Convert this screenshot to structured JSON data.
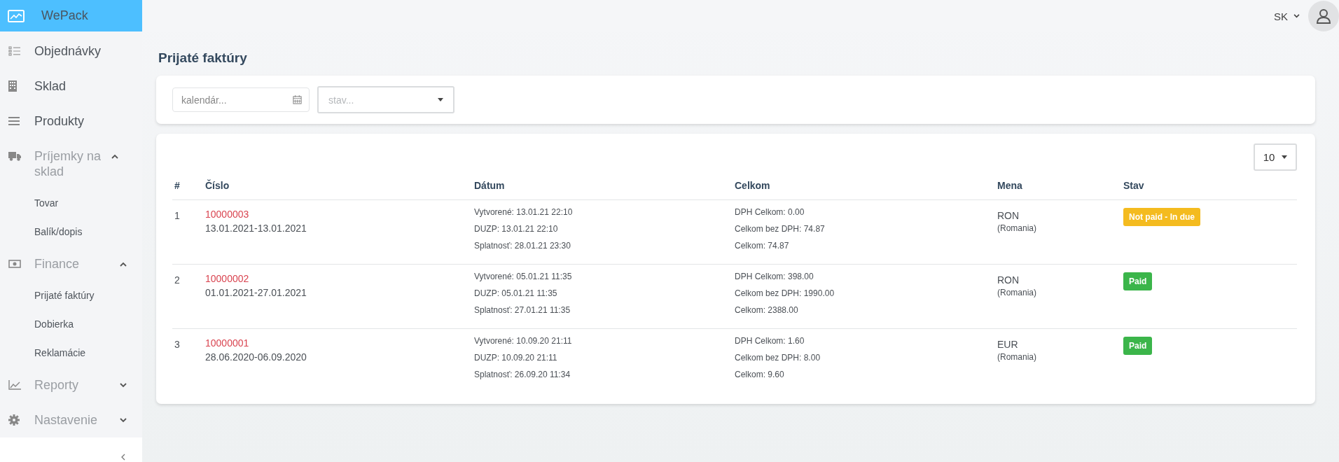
{
  "sidebar": {
    "brand": "WePack",
    "items": [
      {
        "kind": "link",
        "label": "Objednávky"
      },
      {
        "kind": "link",
        "label": "Sklad"
      },
      {
        "kind": "link",
        "label": "Produkty"
      },
      {
        "kind": "group",
        "label": "Príjemky na sklad",
        "expanded": true,
        "children": [
          {
            "label": "Tovar"
          },
          {
            "label": "Balík/dopis"
          }
        ]
      },
      {
        "kind": "group",
        "label": "Finance",
        "expanded": true,
        "children": [
          {
            "label": "Prijaté faktúry"
          },
          {
            "label": "Dobierka"
          },
          {
            "label": "Reklamácie"
          }
        ]
      },
      {
        "kind": "group",
        "label": "Reporty",
        "expanded": false
      },
      {
        "kind": "group",
        "label": "Nastavenie",
        "expanded": false
      }
    ]
  },
  "topbar": {
    "language": "SK"
  },
  "page_title": "Prijaté faktúry",
  "filters": {
    "date_placeholder": "kalendár...",
    "status_placeholder": "stav..."
  },
  "page_size": "10",
  "table": {
    "columns": [
      "#",
      "Číslo",
      "Dátum",
      "Celkom",
      "Mena",
      "Stav"
    ],
    "rows": [
      {
        "index": "1",
        "number": "10000003",
        "period": "13.01.2021-13.01.2021",
        "dates": [
          "Vytvorené: 13.01.21 22:10",
          "DUZP: 13.01.21 22:10",
          "Splatnosť: 28.01.21 23:30"
        ],
        "totals": [
          "DPH Celkom: 0.00",
          "Celkom bez DPH: 74.87",
          "Celkom: 74.87"
        ],
        "currency": "RON",
        "country": "(Romania)",
        "status": "Not paid - In due",
        "color": "#f4bb1f"
      },
      {
        "index": "2",
        "number": "10000002",
        "period": "01.01.2021-27.01.2021",
        "dates": [
          "Vytvorené: 05.01.21 11:35",
          "DUZP: 05.01.21 11:35",
          "Splatnosť: 27.01.21 11:35"
        ],
        "totals": [
          "DPH Celkom: 398.00",
          "Celkom bez DPH: 1990.00",
          "Celkom: 2388.00"
        ],
        "currency": "RON",
        "country": "(Romania)",
        "status": "Paid",
        "color": "#3bb54a"
      },
      {
        "index": "3",
        "number": "10000001",
        "period": "28.06.2020-06.09.2020",
        "dates": [
          "Vytvorené: 10.09.20 21:11",
          "DUZP: 10.09.20 21:11",
          "Splatnosť: 26.09.20 11:34"
        ],
        "totals": [
          "DPH Celkom: 1.60",
          "Celkom bez DPH: 8.00",
          "Celkom: 9.60"
        ],
        "currency": "EUR",
        "country": "(Romania)",
        "status": "Paid",
        "color": "#3bb54a"
      }
    ]
  }
}
